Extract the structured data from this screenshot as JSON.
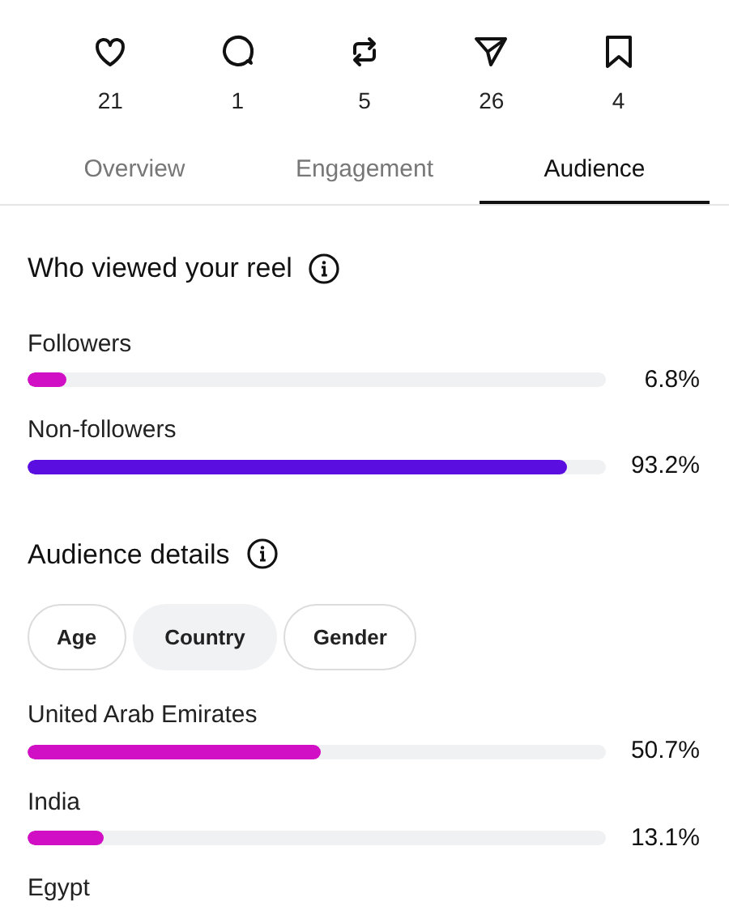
{
  "stats": [
    {
      "kind": "heart",
      "count": "21"
    },
    {
      "kind": "comment",
      "count": "1"
    },
    {
      "kind": "repost",
      "count": "5"
    },
    {
      "kind": "send",
      "count": "26"
    },
    {
      "kind": "bookmark",
      "count": "4"
    }
  ],
  "tabs": [
    {
      "label": "Overview",
      "selected": false
    },
    {
      "label": "Engagement",
      "selected": false
    },
    {
      "label": "Audience",
      "selected": true
    }
  ],
  "viewers": {
    "title": "Who viewed your reel",
    "rows": [
      {
        "label": "Followers",
        "level": 0.068,
        "color": "#d10fc4",
        "reading": "6.8%"
      },
      {
        "label": "Non-followers",
        "level": 0.932,
        "color": "#5a0ee0",
        "reading": "93.2%"
      }
    ]
  },
  "details": {
    "title": "Audience details",
    "chips": [
      {
        "label": "Age",
        "selected": false
      },
      {
        "label": "Country",
        "selected": true
      },
      {
        "label": "Gender",
        "selected": false
      }
    ],
    "rows": [
      {
        "label": "United Arab Emirates",
        "level": 0.507,
        "color": "#d10fc4",
        "reading": "50.7%"
      },
      {
        "label": "India",
        "level": 0.131,
        "color": "#d10fc4",
        "reading": "13.1%"
      },
      {
        "label": "Egypt"
      }
    ]
  }
}
